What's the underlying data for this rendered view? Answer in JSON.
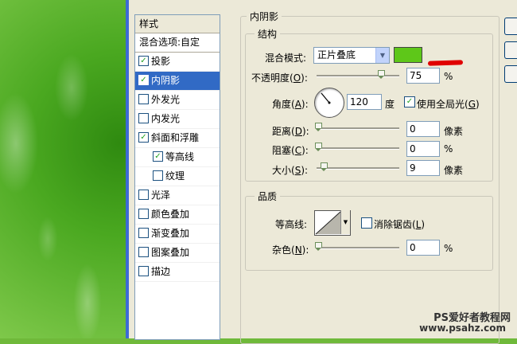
{
  "styles_panel": {
    "header": "样式",
    "items": [
      {
        "label": "混合选项:自定",
        "checkbox": false,
        "checked": false,
        "indent": false,
        "selected": false,
        "kind": "head"
      },
      {
        "label": "投影",
        "checkbox": true,
        "checked": true,
        "indent": false,
        "selected": false
      },
      {
        "label": "内阴影",
        "checkbox": true,
        "checked": true,
        "indent": false,
        "selected": true
      },
      {
        "label": "外发光",
        "checkbox": true,
        "checked": false,
        "indent": false,
        "selected": false
      },
      {
        "label": "内发光",
        "checkbox": true,
        "checked": false,
        "indent": false,
        "selected": false
      },
      {
        "label": "斜面和浮雕",
        "checkbox": true,
        "checked": true,
        "indent": false,
        "selected": false
      },
      {
        "label": "等高线",
        "checkbox": true,
        "checked": true,
        "indent": true,
        "selected": false
      },
      {
        "label": "纹理",
        "checkbox": true,
        "checked": false,
        "indent": true,
        "selected": false
      },
      {
        "label": "光泽",
        "checkbox": true,
        "checked": false,
        "indent": false,
        "selected": false
      },
      {
        "label": "颜色叠加",
        "checkbox": true,
        "checked": false,
        "indent": false,
        "selected": false
      },
      {
        "label": "渐变叠加",
        "checkbox": true,
        "checked": false,
        "indent": false,
        "selected": false
      },
      {
        "label": "图案叠加",
        "checkbox": true,
        "checked": false,
        "indent": false,
        "selected": false
      },
      {
        "label": "描边",
        "checkbox": true,
        "checked": false,
        "indent": false,
        "selected": false
      }
    ]
  },
  "inner_shadow": {
    "title": "内阴影",
    "structure": {
      "title": "结构",
      "blend_mode_label": "混合模式:",
      "blend_mode_value": "正片叠底",
      "color": "#5ec719",
      "opacity_label": "不透明度(",
      "opacity_key": "O",
      "opacity_label_end": "):",
      "opacity_value": "75",
      "opacity_unit": "%",
      "angle_label": "角度(",
      "angle_key": "A",
      "angle_label_end": "):",
      "angle_value": "120",
      "angle_unit": "度",
      "global_light_label": "使用全局光(",
      "global_light_key": "G",
      "global_light_label_end": ")",
      "global_light_checked": true,
      "distance_label": "距离(",
      "distance_key": "D",
      "distance_label_end": "):",
      "distance_value": "0",
      "distance_unit": "像素",
      "choke_label": "阻塞(",
      "choke_key": "C",
      "choke_label_end": "):",
      "choke_value": "0",
      "choke_unit": "%",
      "size_label": "大小(",
      "size_key": "S",
      "size_label_end": "):",
      "size_value": "9",
      "size_unit": "像素"
    },
    "quality": {
      "title": "品质",
      "contour_label": "等高线:",
      "anti_alias_label": "消除锯齿(",
      "anti_alias_key": "L",
      "anti_alias_label_end": ")",
      "anti_alias_checked": false,
      "noise_label": "杂色(",
      "noise_key": "N",
      "noise_label_end": "):",
      "noise_value": "0",
      "noise_unit": "%"
    }
  },
  "watermark": {
    "line1": "PS爱好者教程网",
    "line2": "www.psahz.com"
  }
}
